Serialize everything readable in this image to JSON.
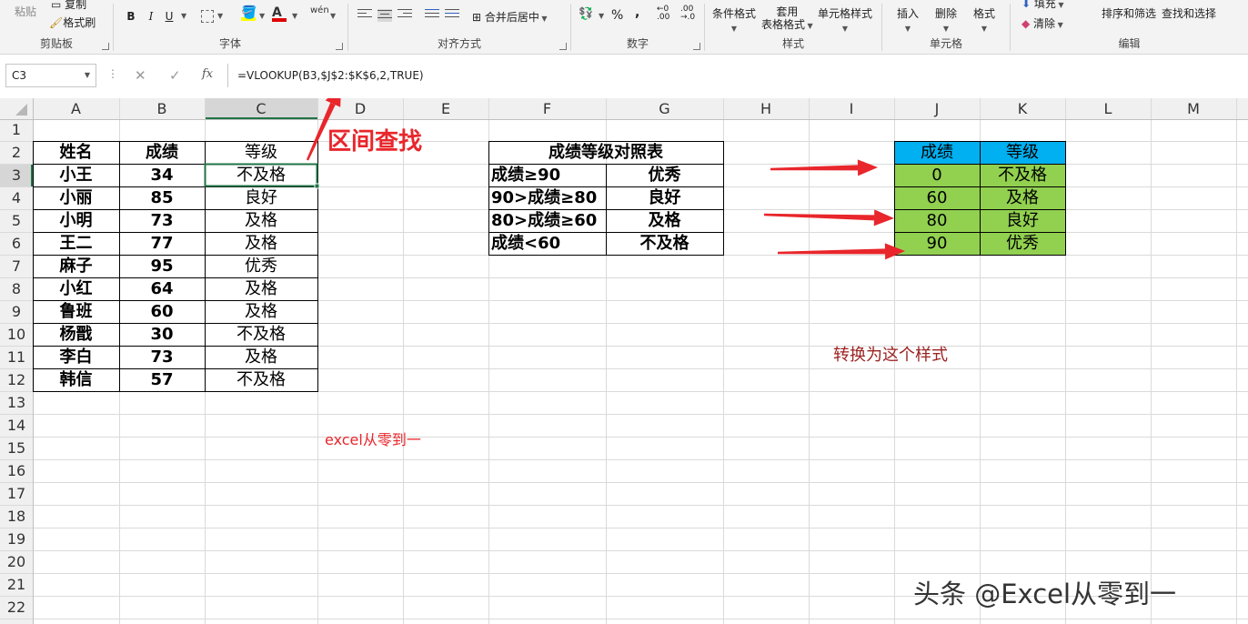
{
  "ribbon": {
    "clipboard": {
      "paste": "粘贴",
      "copy": "复制",
      "format_painter": "格式刷",
      "label": "剪贴板"
    },
    "font": {
      "bold": "B",
      "italic": "I",
      "underline": "U",
      "label": "字体",
      "phonetic": "wén"
    },
    "alignment": {
      "merge_center": "合并后居中",
      "label": "对齐方式"
    },
    "number": {
      "percent": "%",
      "comma": ",",
      "label": "数字"
    },
    "styles": {
      "conditional": "条件格式",
      "table_top": "套用",
      "table_bottom": "表格格式",
      "cell_styles": "单元格样式",
      "label": "样式"
    },
    "cells": {
      "insert": "插入",
      "delete": "删除",
      "format": "格式",
      "label": "单元格"
    },
    "editing": {
      "fill": "填充",
      "clear": "清除",
      "sort_filter": "排序和筛选",
      "find_select": "查找和选择",
      "label": "编辑"
    }
  },
  "formula_bar": {
    "name_box": "C3",
    "fx": "fx",
    "formula": "=VLOOKUP(B3,$J$2:$K$6,2,TRUE)"
  },
  "sheet": {
    "columns": [
      "A",
      "B",
      "C",
      "D",
      "E",
      "F",
      "G",
      "H",
      "I",
      "J",
      "K",
      "L",
      "M"
    ],
    "rows": [
      "1",
      "2",
      "3",
      "4",
      "5",
      "6",
      "7",
      "8",
      "9",
      "10",
      "11",
      "12",
      "13",
      "14",
      "15",
      "16",
      "17",
      "18",
      "19",
      "20",
      "21",
      "22"
    ],
    "main_table": {
      "headers": [
        "姓名",
        "成绩",
        "等级"
      ],
      "rows": [
        [
          "小王",
          "34",
          "不及格"
        ],
        [
          "小丽",
          "85",
          "良好"
        ],
        [
          "小明",
          "73",
          "及格"
        ],
        [
          "王二",
          "77",
          "及格"
        ],
        [
          "麻子",
          "95",
          "优秀"
        ],
        [
          "小红",
          "64",
          "及格"
        ],
        [
          "鲁班",
          "60",
          "及格"
        ],
        [
          "杨戬",
          "30",
          "不及格"
        ],
        [
          "李白",
          "73",
          "及格"
        ],
        [
          "韩信",
          "57",
          "不及格"
        ]
      ]
    },
    "reference_table": {
      "title": "成绩等级对照表",
      "rows": [
        [
          "成绩≥90",
          "优秀"
        ],
        [
          "90>成绩≥80",
          "良好"
        ],
        [
          "80>成绩≥60",
          "及格"
        ],
        [
          "成绩<60",
          "不及格"
        ]
      ]
    },
    "lookup_table": {
      "headers": [
        "成绩",
        "等级"
      ],
      "rows": [
        [
          "0",
          "不及格"
        ],
        [
          "60",
          "及格"
        ],
        [
          "80",
          "良好"
        ],
        [
          "90",
          "优秀"
        ]
      ],
      "header_color": "#00b0f0",
      "body_color": "#92d050"
    }
  },
  "annotations": {
    "range_lookup": "区间查找",
    "convert_style": "转换为这个样式",
    "author_note": "excel从零到一",
    "watermark": "头条 @Excel从零到一",
    "accent_red": "#e8262b",
    "dark_red": "#9c2222"
  }
}
